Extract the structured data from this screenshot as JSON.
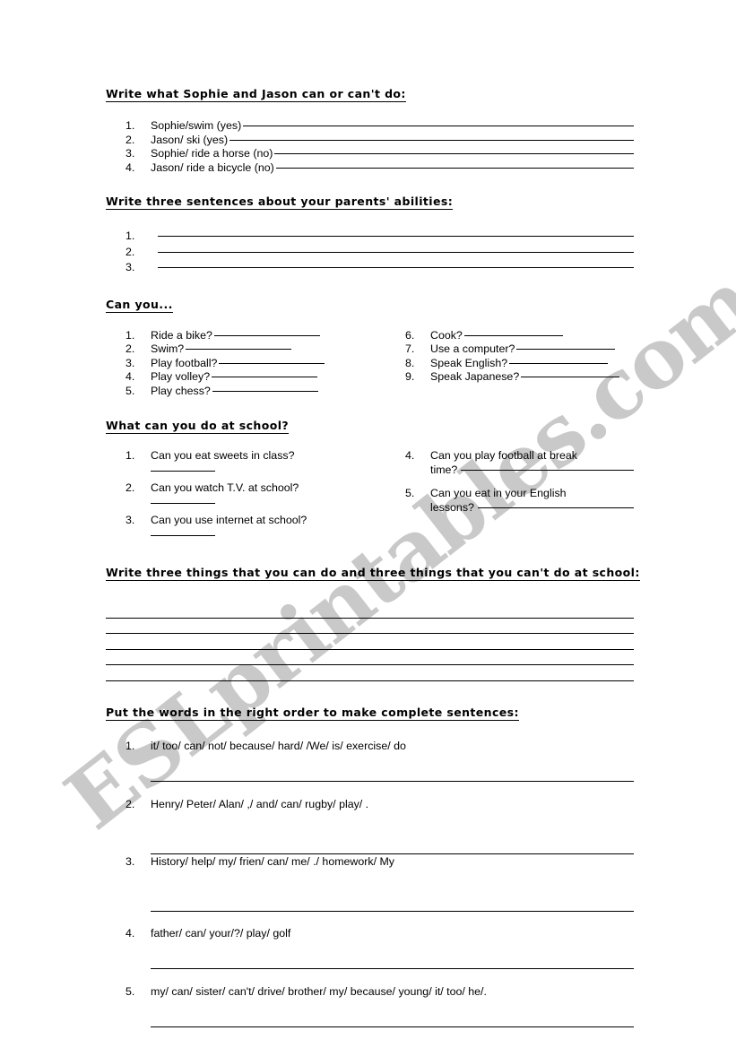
{
  "watermark": {
    "text": "ESLprintables.com",
    "color": "#c9c9c9"
  },
  "sections": {
    "abilities": {
      "heading": "Write what Sophie and Jason can or can't do:",
      "items": [
        {
          "n": "1.",
          "text": "Sophie/swim (yes)"
        },
        {
          "n": "2.",
          "text": "Jason/ ski (yes)"
        },
        {
          "n": "3.",
          "text": "Sophie/ ride a horse (no)"
        },
        {
          "n": "4.",
          "text": "Jason/ ride a bicycle (no)"
        }
      ]
    },
    "parents": {
      "heading": "Write three sentences about your parents' abilities:",
      "items": [
        {
          "n": "1.",
          "text": ""
        },
        {
          "n": "2.",
          "text": ""
        },
        {
          "n": "3.",
          "text": ""
        }
      ]
    },
    "canyou": {
      "heading": "Can you...",
      "column_left": [
        {
          "n": "1.",
          "text": "Ride a bike?"
        },
        {
          "n": "2.",
          "text": "Swim?"
        },
        {
          "n": "3.",
          "text": "Play football?"
        },
        {
          "n": "4.",
          "text": "Play volley?"
        },
        {
          "n": "5.",
          "text": "Play chess?"
        }
      ],
      "column_right": [
        {
          "n": "6.",
          "text": "Cook?"
        },
        {
          "n": "7.",
          "text": "Use a computer?"
        },
        {
          "n": "8.",
          "text": "Speak English?"
        },
        {
          "n": "9.",
          "text": "Speak Japanese?"
        }
      ]
    },
    "school": {
      "heading": "What can you do at school?",
      "column_left": [
        {
          "n": "1.",
          "text": "Can you eat sweets in class?"
        },
        {
          "n": "2.",
          "text": "Can you watch T.V. at school?"
        },
        {
          "n": "3.",
          "text": "Can you use internet at school?"
        }
      ],
      "column_right": [
        {
          "n": "4.",
          "text": "Can you play football at break",
          "tail": "time?"
        },
        {
          "n": "5.",
          "text": "Can you eat in your English",
          "tail": "lessons?"
        }
      ]
    },
    "writethree": {
      "heading": "Write three things that you can do and three things that you can't do at school:",
      "blank_line_count": 5
    },
    "order": {
      "heading": "Put the words in the right order to make complete sentences:",
      "items": [
        {
          "n": "1.",
          "text": "it/ too/ can/ not/ because/ hard/ /We/ is/ exercise/ do"
        },
        {
          "n": "2.",
          "text": "Henry/ Peter/ Alan/ ,/ and/ can/ rugby/ play/ ."
        },
        {
          "n": "3.",
          "text": "History/ help/ my/ frien/ can/ me/ ./ homework/ My"
        },
        {
          "n": "4.",
          "text": "father/ can/ your/?/ play/ golf"
        },
        {
          "n": "5.",
          "text": "my/ can/ sister/ can't/ drive/ brother/ my/ because/ young/ it/ too/ he/."
        }
      ]
    }
  }
}
